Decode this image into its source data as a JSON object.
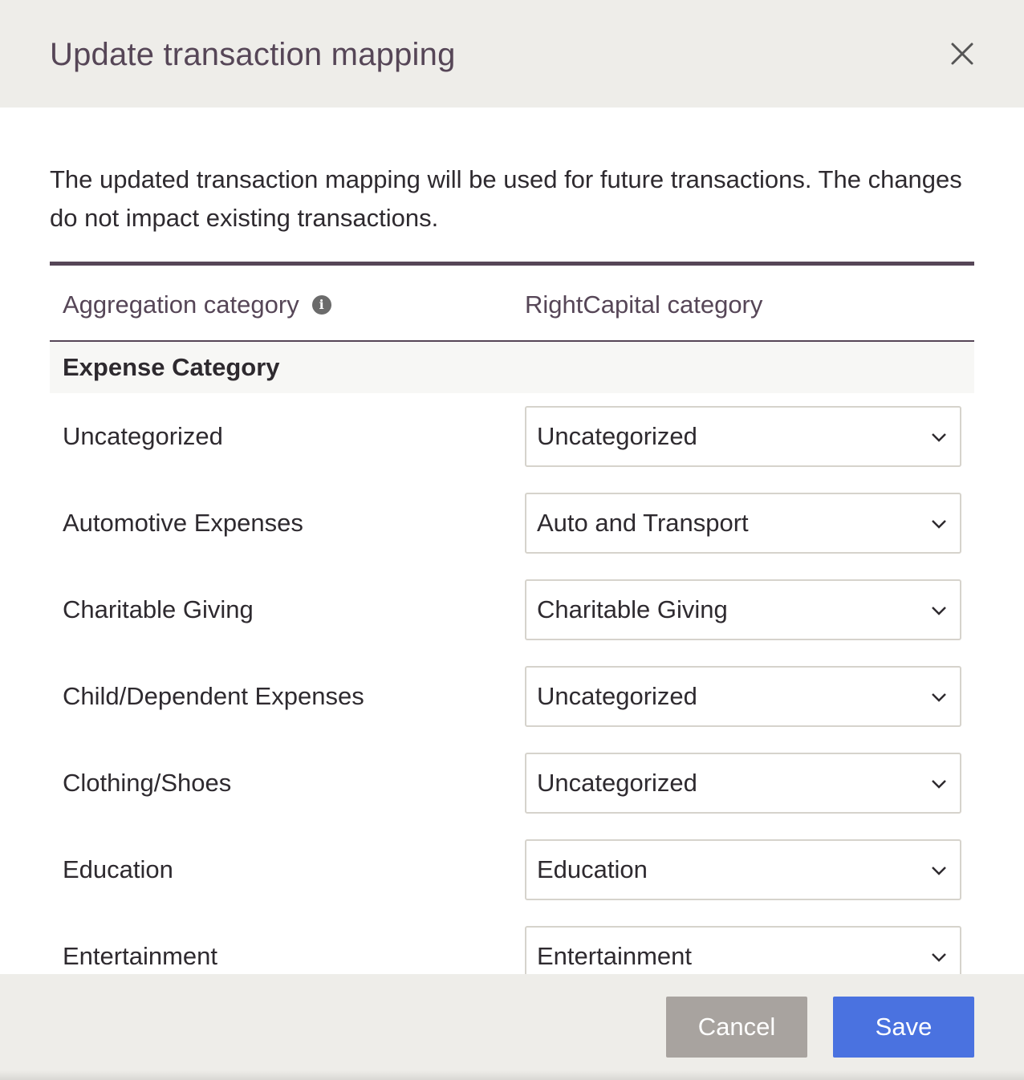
{
  "dialog": {
    "title": "Update transaction mapping",
    "description": "The updated transaction mapping will be used for future transactions. The changes do not impact existing transactions."
  },
  "table": {
    "columns": {
      "aggregation": "Aggregation category",
      "rightcapital": "RightCapital category"
    },
    "group_label": "Expense Category",
    "rows": [
      {
        "aggregation": "Uncategorized",
        "rightcapital": "Uncategorized"
      },
      {
        "aggregation": "Automotive Expenses",
        "rightcapital": "Auto and Transport"
      },
      {
        "aggregation": "Charitable Giving",
        "rightcapital": "Charitable Giving"
      },
      {
        "aggregation": "Child/Dependent Expenses",
        "rightcapital": "Uncategorized"
      },
      {
        "aggregation": "Clothing/Shoes",
        "rightcapital": "Uncategorized"
      },
      {
        "aggregation": "Education",
        "rightcapital": "Education"
      },
      {
        "aggregation": "Entertainment",
        "rightcapital": "Entertainment"
      }
    ]
  },
  "footer": {
    "cancel_label": "Cancel",
    "save_label": "Save"
  },
  "icons": {
    "close": "close-icon",
    "info": "info-icon",
    "chevron": "chevron-down-icon"
  },
  "colors": {
    "title": "#564657",
    "accent_rule": "#564657",
    "save": "#4a72e0",
    "cancel": "#a8a39f",
    "header_bg": "#eeede9"
  }
}
